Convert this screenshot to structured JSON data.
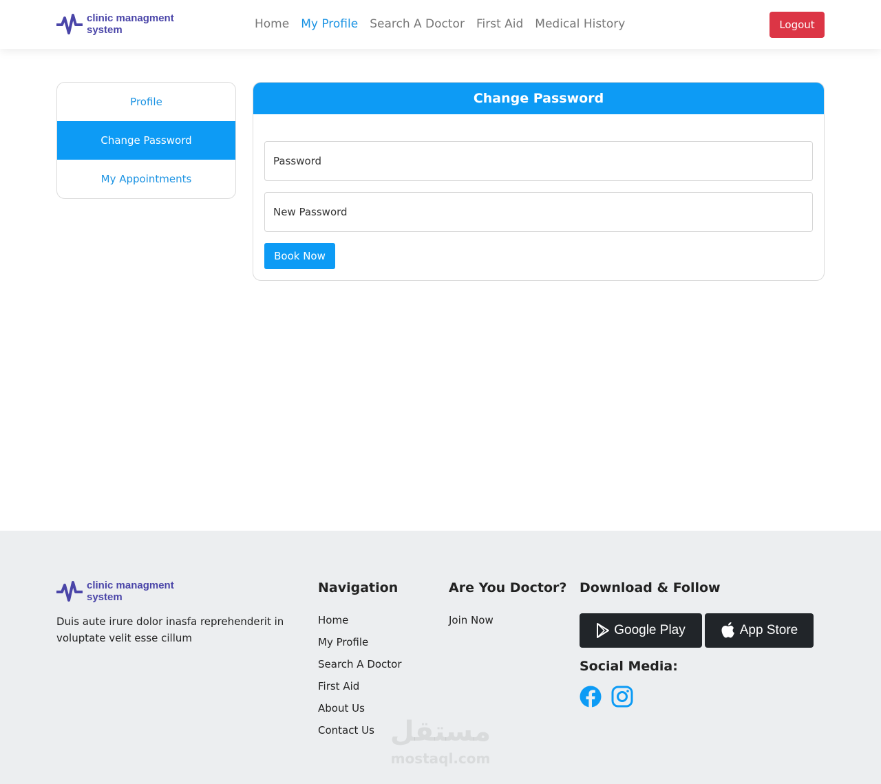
{
  "brand": {
    "line1": "clinic managment",
    "line2": "system",
    "color": "#4a45a8"
  },
  "nav": {
    "links": [
      {
        "label": "Home",
        "active": false
      },
      {
        "label": "My Profile",
        "active": true
      },
      {
        "label": "Search A Doctor",
        "active": false
      },
      {
        "label": "First Aid",
        "active": false
      },
      {
        "label": "Medical History",
        "active": false
      }
    ],
    "logout_label": "Logout"
  },
  "sidebar": {
    "items": [
      {
        "label": "Profile",
        "active": false
      },
      {
        "label": "Change Password",
        "active": true
      },
      {
        "label": "My Appointments",
        "active": false
      }
    ]
  },
  "form": {
    "title": "Change Password",
    "password_placeholder": "Password",
    "new_password_placeholder": "New Password",
    "submit_label": "Book Now"
  },
  "footer": {
    "description": "Duis aute irure dolor inasfa reprehenderit in voluptate velit esse cillum",
    "navigation": {
      "heading": "Navigation",
      "links": [
        "Home",
        "My Profile",
        "Search A Doctor",
        "First Aid",
        "About Us",
        "Contact Us"
      ]
    },
    "doctor": {
      "heading": "Are You Doctor?",
      "links": [
        "Join Now"
      ]
    },
    "download": {
      "heading": "Download & Follow",
      "google_play": "Google Play",
      "app_store": "App Store"
    },
    "social": {
      "heading": "Social Media:",
      "icons": [
        "facebook-icon",
        "instagram-icon"
      ]
    }
  },
  "watermark": {
    "arabic": "مستقل",
    "latin": "mostaql.com"
  },
  "colors": {
    "primary": "#0d9bf5",
    "link": "#1b93e3",
    "danger": "#dc3545",
    "dark": "#212529",
    "footer_bg": "#eceef0"
  }
}
